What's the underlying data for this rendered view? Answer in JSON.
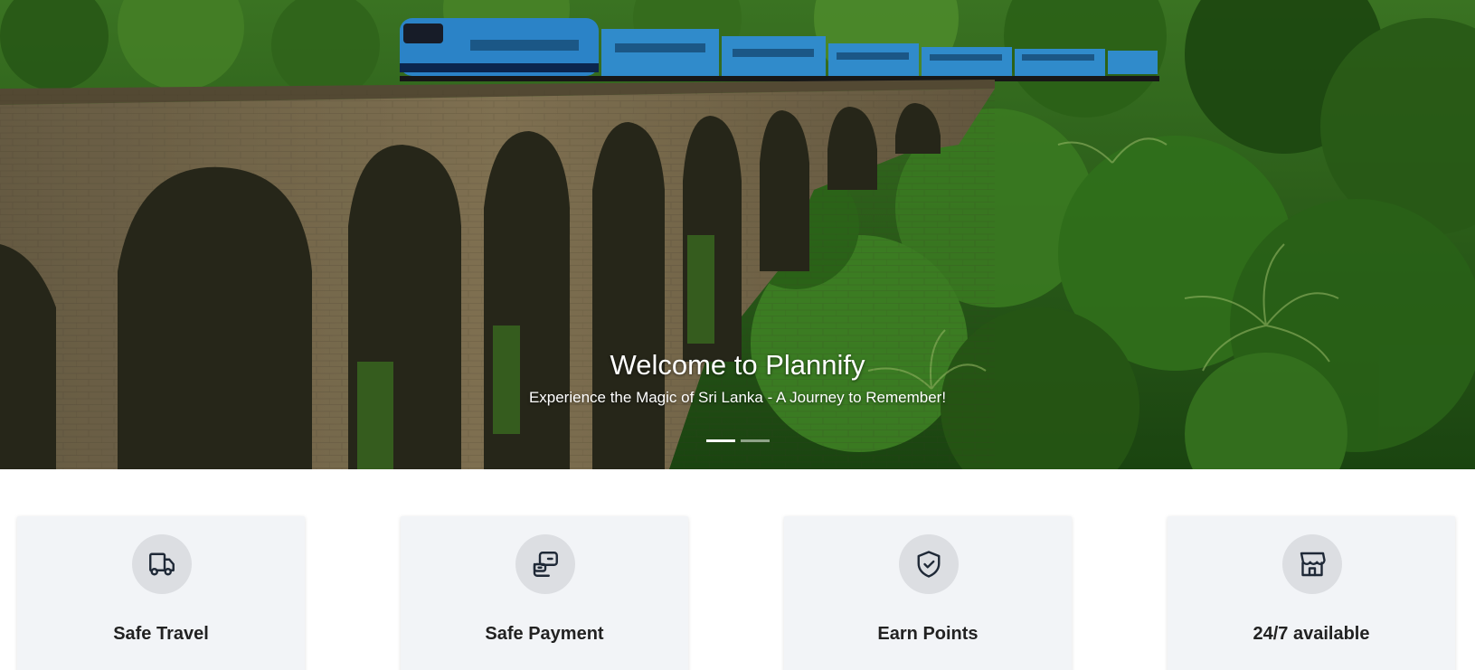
{
  "hero": {
    "title": "Welcome to Plannify",
    "subtitle": "Experience the Magic of Sri Lanka - A Journey to Remember!",
    "slides": [
      {
        "name": "slide-1",
        "active": true
      },
      {
        "name": "slide-2",
        "active": false
      }
    ]
  },
  "features": [
    {
      "label": "Safe Travel",
      "icon": "truck-icon"
    },
    {
      "label": "Safe Payment",
      "icon": "payment-icon"
    },
    {
      "label": "Earn Points",
      "icon": "shield-check-icon"
    },
    {
      "label": "24/7 available",
      "icon": "store-icon"
    }
  ],
  "colors": {
    "card_bg": "#f2f4f7",
    "icon_circle": "#dcdee2",
    "train_blue": "#2f8fd8",
    "jungle": "#2e6b1c"
  }
}
